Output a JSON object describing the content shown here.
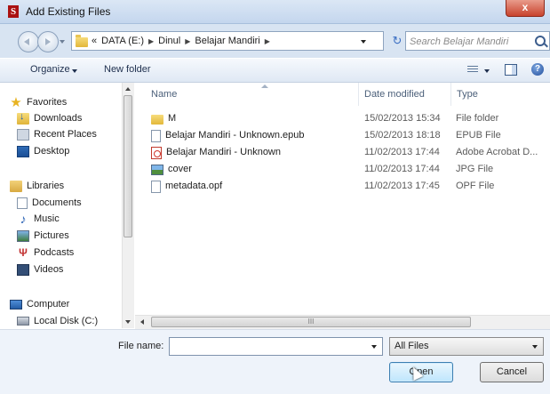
{
  "window": {
    "title": "Add Existing Files",
    "app_icon_letter": "S",
    "close_glyph": "x"
  },
  "address": {
    "crumbs": [
      "«",
      "DATA (E:)",
      "Dinul",
      "Belajar Mandiri"
    ],
    "separator": "▶",
    "refresh_glyph": "↻"
  },
  "search": {
    "placeholder": "Search Belajar Mandiri"
  },
  "toolbar": {
    "organize": "Organize",
    "new_folder": "New folder",
    "help_glyph": "?"
  },
  "nav": {
    "favorites": "Favorites",
    "favorites_items": [
      "Downloads",
      "Recent Places",
      "Desktop"
    ],
    "libraries": "Libraries",
    "library_items": [
      "Documents",
      "Music",
      "Pictures",
      "Podcasts",
      "Videos"
    ],
    "computer": "Computer",
    "computer_items": [
      "Local Disk (C:)"
    ]
  },
  "files": {
    "columns": {
      "name": "Name",
      "date": "Date modified",
      "type": "Type"
    },
    "rows": [
      {
        "name": "M",
        "date": "15/02/2013 15:34",
        "type": "File folder",
        "icon": "folder-icon"
      },
      {
        "name": "Belajar Mandiri - Unknown.epub",
        "date": "15/02/2013 18:18",
        "type": "EPUB File",
        "icon": "file-icon"
      },
      {
        "name": "Belajar Mandiri - Unknown",
        "date": "11/02/2013 17:44",
        "type": "Adobe Acrobat D...",
        "icon": "pdf-icon"
      },
      {
        "name": "cover",
        "date": "11/02/2013 17:44",
        "type": "JPG File",
        "icon": "image-icon"
      },
      {
        "name": "metadata.opf",
        "date": "11/02/2013 17:45",
        "type": "OPF File",
        "icon": "file-icon"
      }
    ]
  },
  "scroll": {
    "grip": "III"
  },
  "footer": {
    "file_name_label": "File name:",
    "file_name_value": "",
    "filter": "All Files",
    "open": "Open",
    "cancel": "Cancel"
  }
}
